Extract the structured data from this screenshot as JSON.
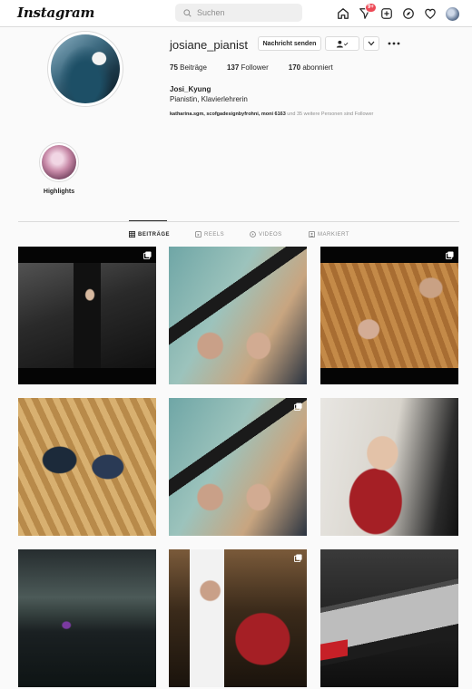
{
  "app": {
    "logo_text": "Instagram"
  },
  "search": {
    "placeholder": "Suchen"
  },
  "nav": {
    "icons": [
      "home-icon",
      "direct-messages-icon",
      "new-post-icon",
      "explore-icon",
      "activity-heart-icon",
      "profile-avatar"
    ],
    "messages_badge": "9+"
  },
  "profile": {
    "username": "josiane_pianist",
    "message_button": "Nachricht senden",
    "stats": {
      "posts_count": "75",
      "posts_label": "Beiträge",
      "followers_count": "137",
      "followers_label": "Follower",
      "following_count": "170",
      "following_label": "abonniert"
    },
    "full_name": "Josi_Kyung",
    "bio": "Pianistin, Klavierlehrerin",
    "followed_by": {
      "names": "katharina.sgm, scofgadesignbyfrohni, moni 6163",
      "suffix": "und 35 weitere Personen sind Follower"
    }
  },
  "highlights": {
    "label": "Highlights"
  },
  "tabs": [
    {
      "label": "BEITRÄGE",
      "icon": "grid-icon",
      "active": true
    },
    {
      "label": "REELS",
      "icon": "reels-icon",
      "active": false
    },
    {
      "label": "VIDEOS",
      "icon": "video-icon",
      "active": false
    },
    {
      "label": "MARKIERT",
      "icon": "tagged-icon",
      "active": false
    }
  ],
  "posts": [
    {
      "id": "post-1",
      "multi": true
    },
    {
      "id": "post-2",
      "multi": false
    },
    {
      "id": "post-3",
      "multi": true
    },
    {
      "id": "post-4",
      "multi": false
    },
    {
      "id": "post-5",
      "multi": true
    },
    {
      "id": "post-6",
      "multi": false
    },
    {
      "id": "post-7",
      "multi": false
    },
    {
      "id": "post-8",
      "multi": true
    },
    {
      "id": "post-9",
      "multi": false
    }
  ],
  "colors": {
    "background": "#fafafa",
    "border": "#dbdbdb",
    "text": "#262626",
    "muted": "#8e8e8e",
    "badge": "#ed4956"
  }
}
